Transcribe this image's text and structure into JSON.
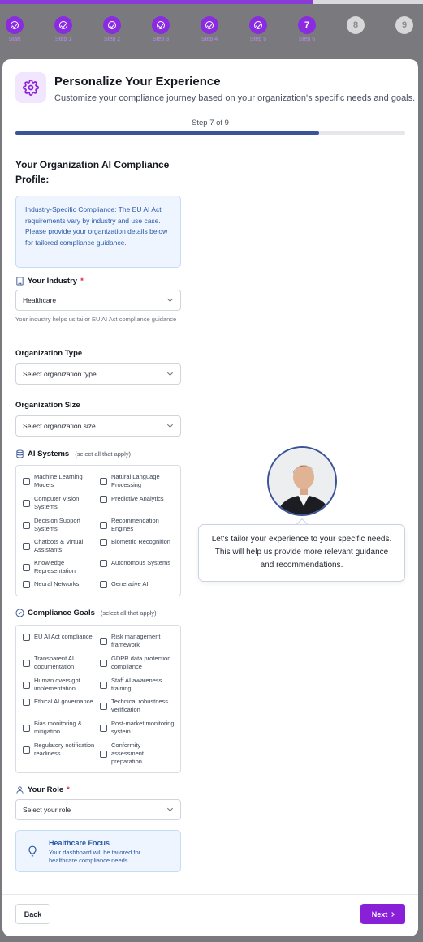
{
  "stepper": {
    "progress": 0.74,
    "steps": [
      {
        "label": "Start",
        "state": "done"
      },
      {
        "label": "Step 1",
        "state": "done"
      },
      {
        "label": "Step 2",
        "state": "done"
      },
      {
        "label": "Step 3",
        "state": "done"
      },
      {
        "label": "Step 4",
        "state": "done"
      },
      {
        "label": "Step 5",
        "state": "done"
      },
      {
        "label": "Step 6",
        "state": "current",
        "number": "7"
      },
      {
        "label": "",
        "state": "pending",
        "number": "8"
      },
      {
        "label": "",
        "state": "pending",
        "number": "9"
      }
    ]
  },
  "header": {
    "title": "Personalize Your Experience",
    "subtitle": "Customize your compliance journey based on your organization's specific needs and goals.",
    "step_text": "Step 7 of 9",
    "step_progress": 0.78,
    "icon": "gear-icon"
  },
  "profile": {
    "section_title": "Your Organization AI Compliance Profile:",
    "info": "Industry-Specific Compliance: The EU AI Act requirements vary by industry and use case. Please provide your organization details below for tailored compliance guidance."
  },
  "industry": {
    "label": "Your Industry",
    "required": "*",
    "value": "Healthcare",
    "help": "Your industry helps us tailor EU AI Act compliance guidance"
  },
  "org_type": {
    "label": "Organization Type",
    "placeholder": "Select organization type"
  },
  "org_size": {
    "label": "Organization Size",
    "placeholder": "Select organization size"
  },
  "ai_systems": {
    "label": "AI Systems",
    "hint": "(select all that apply)",
    "options": [
      "Machine Learning Models",
      "Natural Language Processing",
      "Computer Vision Systems",
      "Predictive Analytics",
      "Decision Support Systems",
      "Recommendation Engines",
      "Chatbots & Virtual Assistants",
      "Biometric Recognition",
      "Knowledge Representation",
      "Autonomous Systems",
      "Neural Networks",
      "Generative AI"
    ]
  },
  "goals": {
    "label": "Compliance Goals",
    "hint": "(select all that apply)",
    "options": [
      "EU AI Act compliance",
      "Risk management framework",
      "Transparent AI documentation",
      "GDPR data protection compliance",
      "Human oversight implementation",
      "Staff AI awareness training",
      "Ethical AI governance",
      "Technical robustness verification",
      "Bias monitoring & mitigation",
      "Post-market monitoring system",
      "Regulatory notification readiness",
      "Conformity assessment preparation"
    ]
  },
  "role": {
    "label": "Your Role",
    "required": "*",
    "placeholder": "Select your role"
  },
  "focus": {
    "title": "Healthcare Focus",
    "desc": "Your dashboard will be tailored for healthcare compliance needs."
  },
  "assistant": {
    "message": "Let's tailor your experience to your specific needs. This will help us provide more relevant guidance and recommendations."
  },
  "footer": {
    "back": "Back",
    "next": "Next"
  },
  "colors": {
    "brand": "#8a1fd8",
    "progress": "#3a5597",
    "info_bg": "#eef5ff",
    "info_text": "#2b5aa6"
  }
}
